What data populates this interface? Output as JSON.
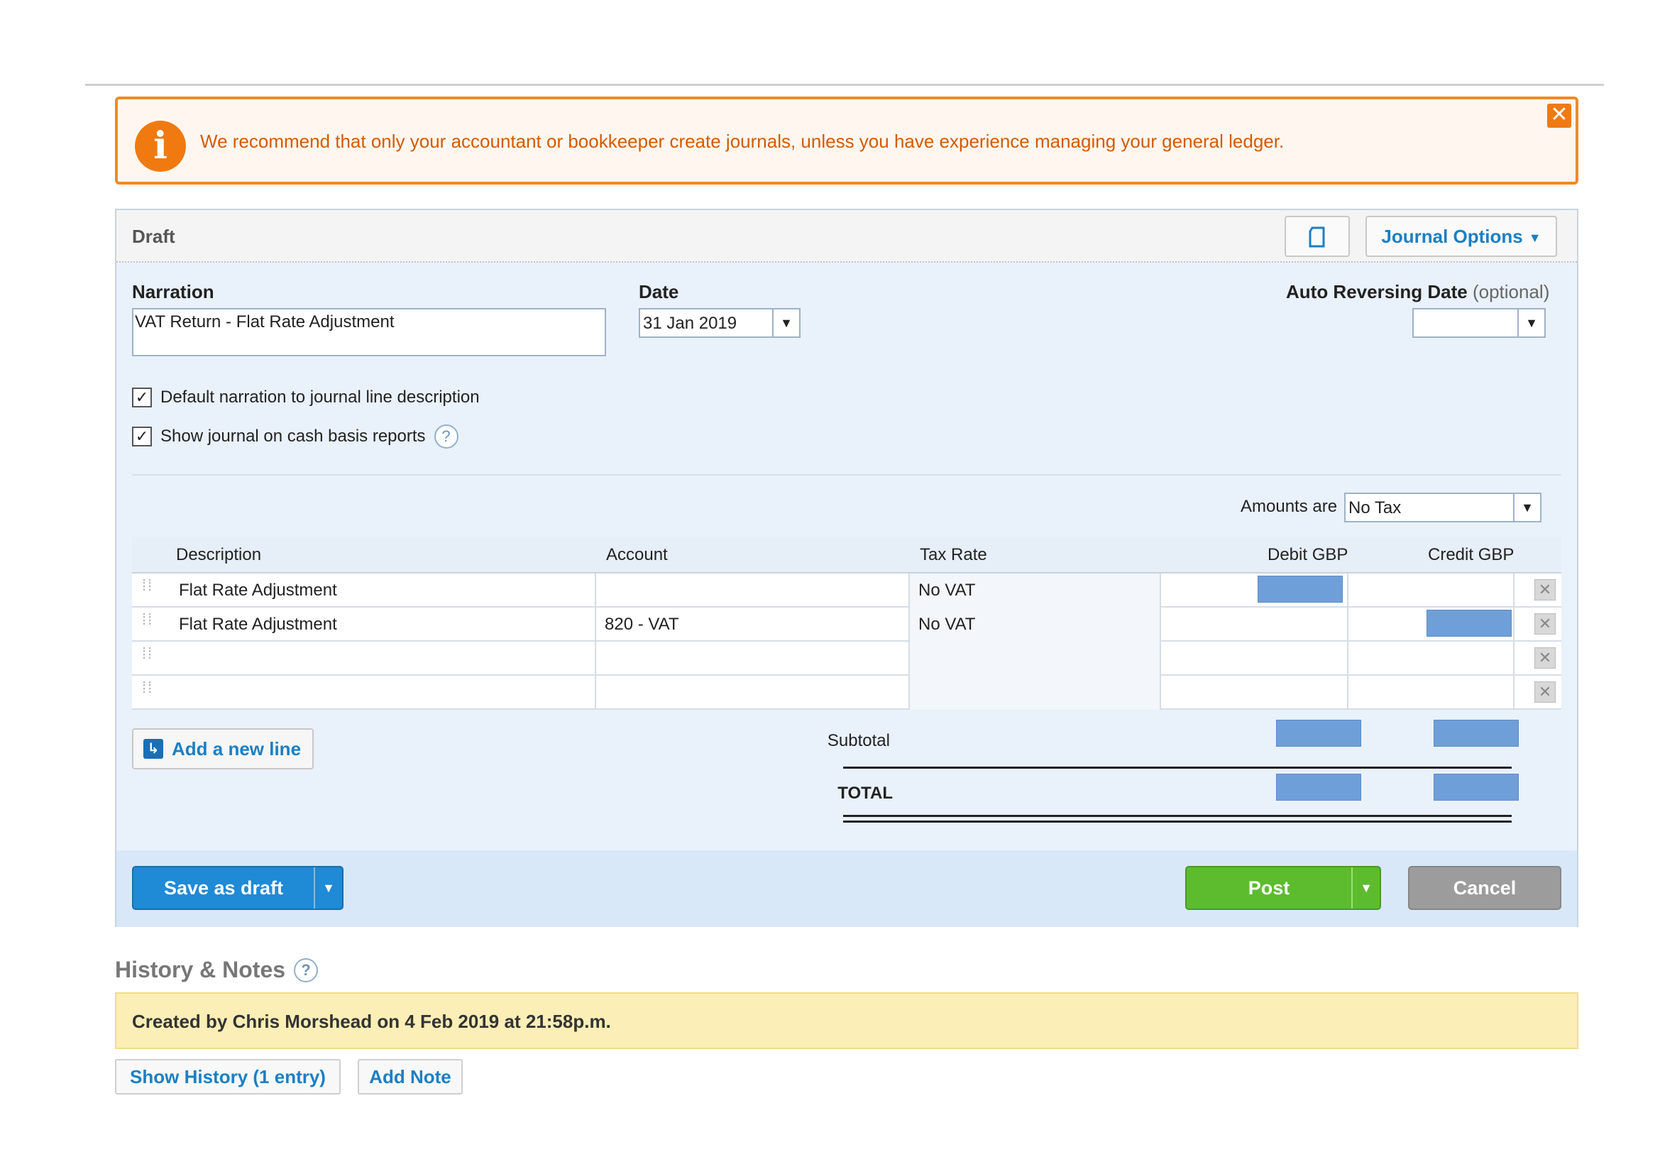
{
  "banner": {
    "icon": "info-icon",
    "text": "We recommend that only your accountant or bookkeeper create journals, unless you have experience managing your general ledger.",
    "close": "✕",
    "color": "#f08a24"
  },
  "panel": {
    "status": "Draft",
    "print_icon": "print-icon",
    "journal_options_label": "Journal Options",
    "narration_label": "Narration",
    "narration_value": "VAT Return - Flat Rate Adjustment",
    "date_label": "Date",
    "date_value": "31 Jan 2019",
    "auto_reversing_label": "Auto Reversing Date",
    "auto_reversing_optional": "(optional)",
    "auto_reversing_value": "",
    "checkbox_default_narration": "Default narration to journal line description",
    "checkbox_cash_basis": "Show journal on cash basis reports",
    "amounts_are_label": "Amounts are",
    "amounts_are_value": "No Tax"
  },
  "table": {
    "headers": {
      "description": "Description",
      "account": "Account",
      "tax_rate": "Tax Rate",
      "debit": "Debit GBP",
      "credit": "Credit GBP"
    },
    "rows": [
      {
        "description": "Flat Rate Adjustment",
        "account": "",
        "tax_rate": "No VAT"
      },
      {
        "description": "Flat Rate Adjustment",
        "account": "820 - VAT",
        "tax_rate": "No VAT"
      },
      {
        "description": "",
        "account": "",
        "tax_rate": ""
      },
      {
        "description": "",
        "account": "",
        "tax_rate": ""
      }
    ],
    "add_line_label": "Add a new line",
    "subtotal_label": "Subtotal",
    "total_label": "TOTAL",
    "redaction_color": "#6f9fd8"
  },
  "actions": {
    "save_draft_label": "Save as draft",
    "post_label": "Post",
    "cancel_label": "Cancel"
  },
  "history": {
    "title": "History & Notes",
    "note": "Created by Chris Morshead on 4 Feb 2019 at 21:58p.m.",
    "show_history_label": "Show History (1 entry)",
    "add_note_label": "Add Note"
  }
}
